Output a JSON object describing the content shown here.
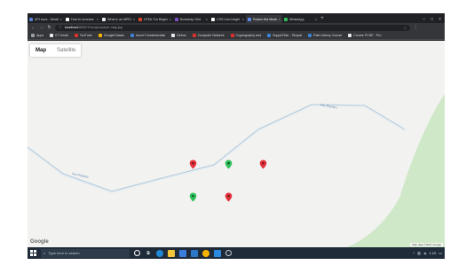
{
  "browser": {
    "tabs": [
      {
        "label": "API docs - Weath",
        "color": "#5b7fd6",
        "active": false
      },
      {
        "label": "How to increase",
        "color": "#ffffff",
        "active": false
      },
      {
        "label": "What is an MPEG",
        "color": "#e8eaed",
        "active": false
      },
      {
        "label": "HTML For Beginn",
        "color": "#e0452c",
        "active": false
      },
      {
        "label": "Bootstrap Grid",
        "color": "#7b4fc7",
        "active": false
      },
      {
        "label": "CSS Line-height",
        "color": "#ffffff",
        "active": false
      },
      {
        "label": "Fusion Hot Moots",
        "color": "#5b8def",
        "active": true
      },
      {
        "label": "WhatsApp",
        "color": "#2fbe5b",
        "active": false
      }
    ],
    "new_tab": "+",
    "address_bar": {
      "host": "localhost",
      "path": "/8000/Trocup/custom-map.jsp"
    },
    "bookmarks": [
      {
        "label": "Apps",
        "color": "#9aa0a6"
      },
      {
        "label": "IIT Gmail",
        "color": "#e8eaed"
      },
      {
        "label": "YouTube",
        "color": "#e0302c"
      },
      {
        "label": "GoogleClassic",
        "color": "#f4b400"
      },
      {
        "label": "Azure Fundamentals",
        "color": "#3b82d6"
      },
      {
        "label": "Debus",
        "color": "#e8eaed"
      },
      {
        "label": "Computer Network",
        "color": "#e0302c"
      },
      {
        "label": "Cryptography and",
        "color": "#e0302c"
      },
      {
        "label": "SuppeZHar - Shopat",
        "color": "#3b82d6"
      },
      {
        "label": "Paid Udemy Course",
        "color": "#3b82d6"
      },
      {
        "label": "Course PCNF - Pro",
        "color": "#e8eaed"
      }
    ]
  },
  "map": {
    "type_control": {
      "map_label": "Map",
      "satellite_label": "Satellite"
    },
    "road_labels": [
      "Fez Planton",
      "Fez Planton"
    ],
    "logo": "Google",
    "attribution": "Map data ©2021 Google",
    "markers": [
      {
        "color": "#e5313c"
      },
      {
        "color": "#2fc25c"
      },
      {
        "color": "#e5313c"
      },
      {
        "color": "#2fc25c"
      },
      {
        "color": "#e5313c"
      }
    ]
  },
  "taskbar": {
    "search_placeholder": "Type here to search",
    "time": "1:19"
  }
}
